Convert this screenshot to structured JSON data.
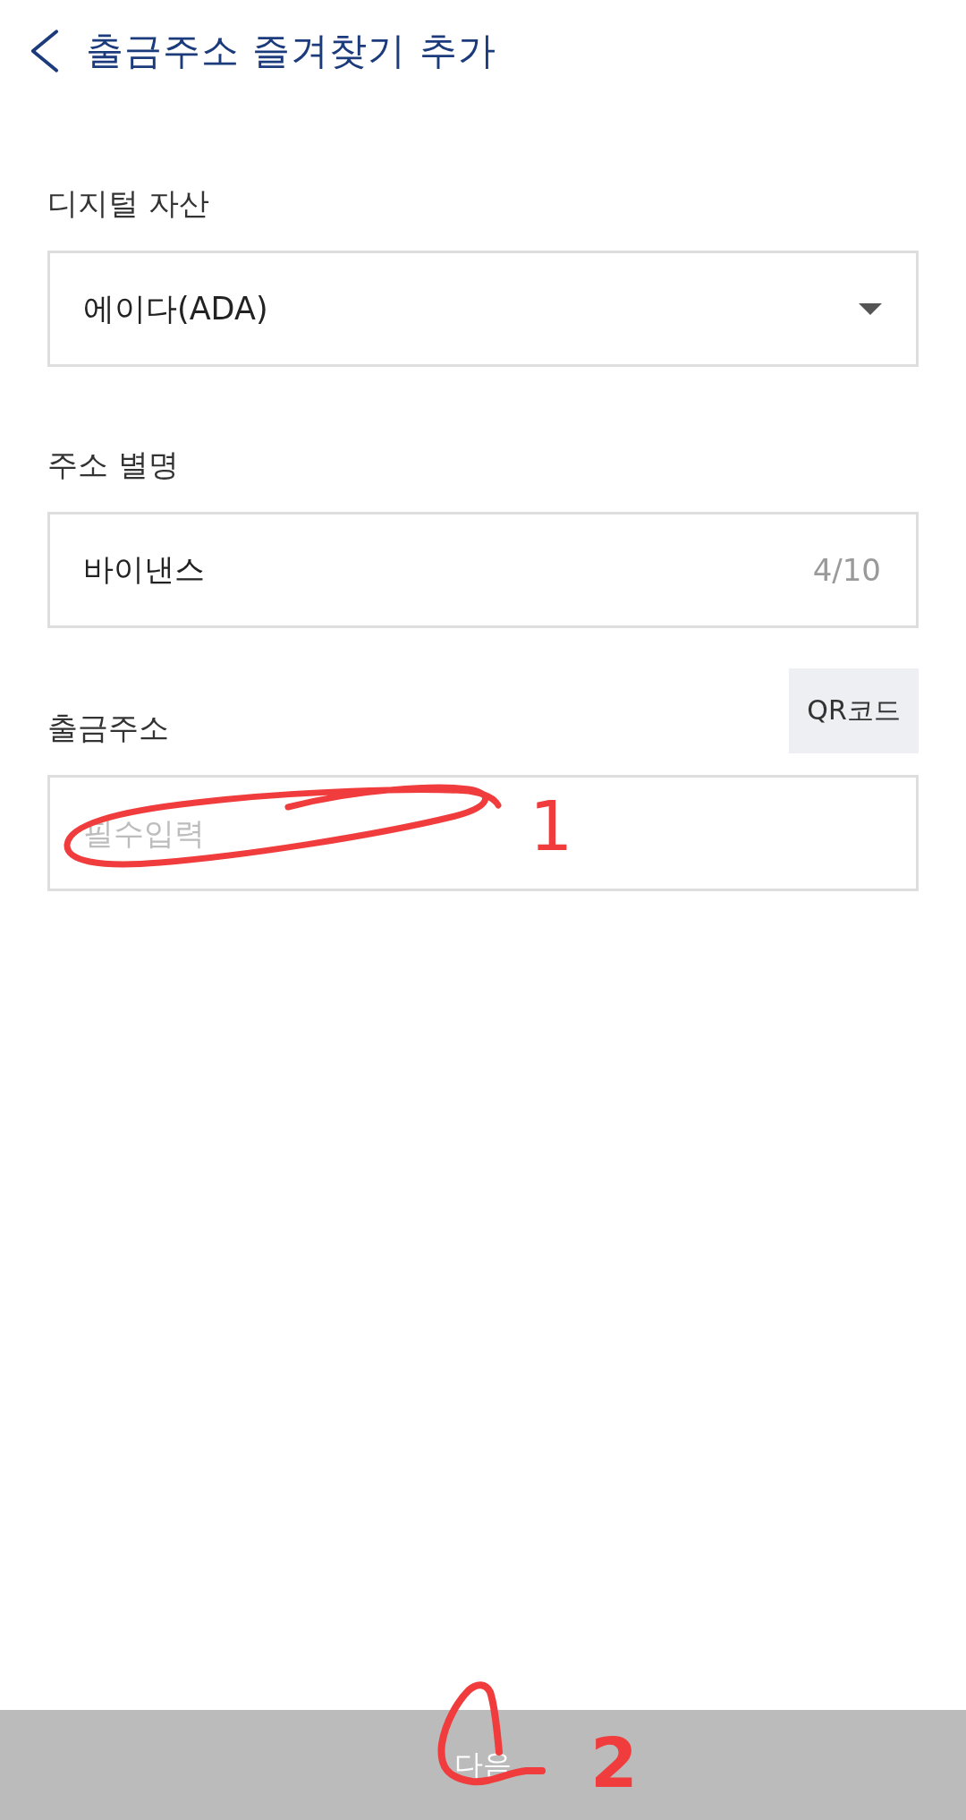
{
  "header": {
    "title": "출금주소 즐겨찾기 추가"
  },
  "fields": [
    {
      "kind": "select",
      "label": "디지털 자산",
      "value": "에이다(ADA)"
    },
    {
      "kind": "text",
      "label": "주소 별명",
      "value": "바이낸스",
      "counter": "4/10"
    },
    {
      "kind": "text",
      "label": "출금주소",
      "placeholder": "필수입력",
      "action": "QR코드"
    }
  ],
  "next_button": {
    "label": "다음",
    "disabled": true
  },
  "annotations": [
    {
      "kind": "ellipse",
      "number": "1"
    },
    {
      "kind": "loop",
      "number": "2"
    }
  ]
}
